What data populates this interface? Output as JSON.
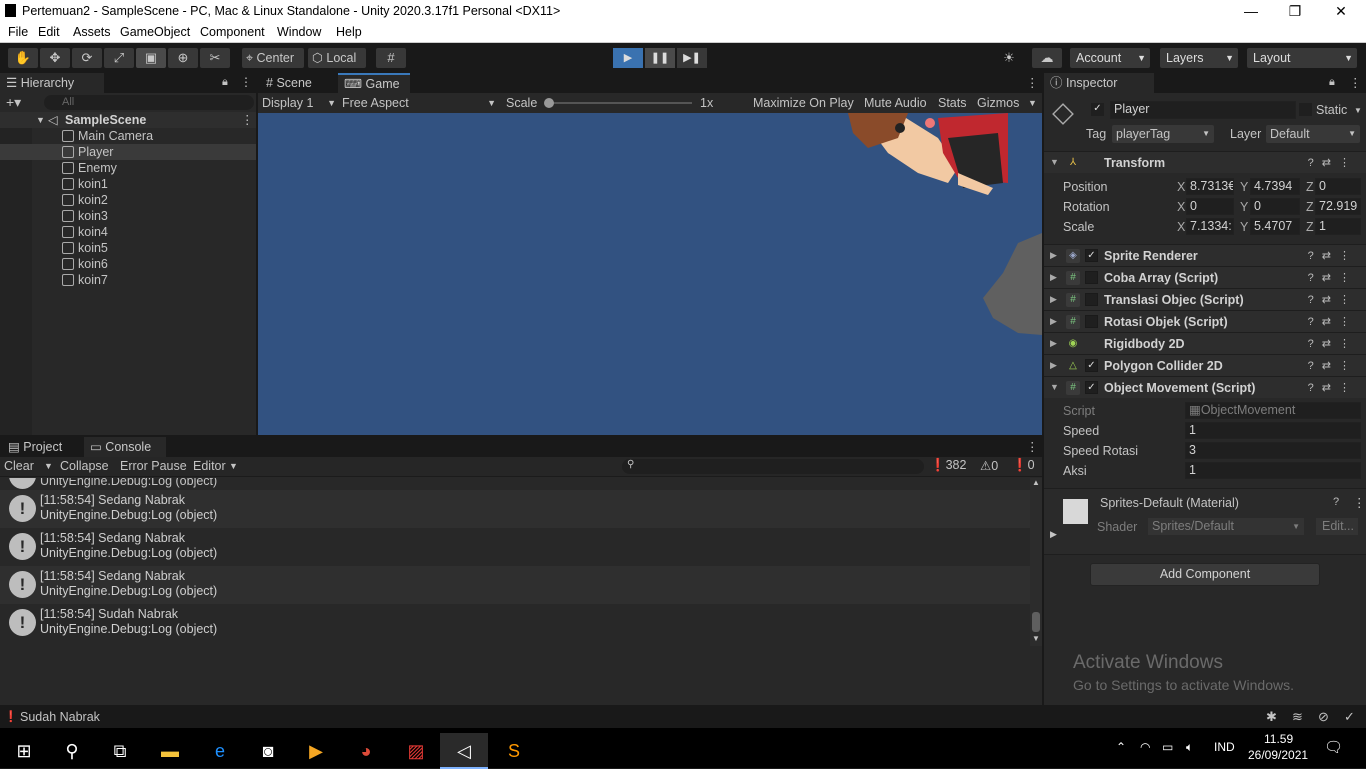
{
  "window": {
    "title": "Pertemuan2 - SampleScene - PC, Mac & Linux Standalone - Unity 2020.3.17f1 Personal <DX11>"
  },
  "menu": [
    "File",
    "Edit",
    "Assets",
    "GameObject",
    "Component",
    "Window",
    "Help"
  ],
  "toolbar": {
    "center": "Center",
    "local": "Local",
    "account": "Account",
    "layers": "Layers",
    "layout": "Layout"
  },
  "hierarchy": {
    "tab": "Hierarchy",
    "search_placeholder": "All",
    "scene": "SampleScene",
    "items": [
      "Main Camera",
      "Player",
      "Enemy",
      "koin1",
      "koin2",
      "koin3",
      "koin4",
      "koin5",
      "koin6",
      "koin7"
    ]
  },
  "gameview": {
    "tabs": [
      "Scene",
      "Game"
    ],
    "display": "Display 1",
    "aspect": "Free Aspect",
    "scale_label": "Scale",
    "scale_value": "1x",
    "buttons": [
      "Maximize On Play",
      "Mute Audio",
      "Stats",
      "Gizmos"
    ]
  },
  "console": {
    "tabs": [
      "Project",
      "Console"
    ],
    "buttons": [
      "Clear",
      "Collapse",
      "Error Pause",
      "Editor"
    ],
    "counts": {
      "log": "382",
      "warn": "0",
      "error": "0"
    },
    "partial_line": "UnityEngine.Debug:Log (object)",
    "logs": [
      {
        "msg": "[11:58:54] Sedang Nabrak",
        "trace": "UnityEngine.Debug:Log (object)"
      },
      {
        "msg": "[11:58:54] Sedang Nabrak",
        "trace": "UnityEngine.Debug:Log (object)"
      },
      {
        "msg": "[11:58:54] Sedang Nabrak",
        "trace": "UnityEngine.Debug:Log (object)"
      },
      {
        "msg": "[11:58:54] Sudah Nabrak",
        "trace": "UnityEngine.Debug:Log (object)"
      }
    ]
  },
  "inspector": {
    "tab": "Inspector",
    "object_name": "Player",
    "static": "Static",
    "tag_label": "Tag",
    "tag": "playerTag",
    "layer_label": "Layer",
    "layer": "Default",
    "transform": {
      "title": "Transform",
      "position_label": "Position",
      "position": {
        "x": "8.7313€",
        "y": "4.7394",
        "z": "0"
      },
      "rotation_label": "Rotation",
      "rotation": {
        "x": "0",
        "y": "0",
        "z": "72.919"
      },
      "scale_label": "Scale",
      "scale": {
        "x": "7.1334:",
        "y": "5.4707",
        "z": "1"
      }
    },
    "components": [
      "Sprite Renderer",
      "Coba Array (Script)",
      "Translasi Objec (Script)",
      "Rotasi Objek (Script)",
      "Rigidbody 2D",
      "Polygon Collider 2D",
      "Object Movement (Script)"
    ],
    "script_fields": {
      "script_label": "Script",
      "script": "ObjectMovement",
      "speed_label": "Speed",
      "speed": "1",
      "speed_rot_label": "Speed Rotasi",
      "speed_rot": "3",
      "aksi_label": "Aksi",
      "aksi": "1"
    },
    "material": {
      "name": "Sprites-Default (Material)",
      "shader_label": "Shader",
      "shader": "Sprites/Default",
      "edit": "Edit..."
    },
    "add_component": "Add Component",
    "activate_title": "Activate Windows",
    "activate_sub": "Go to Settings to activate Windows."
  },
  "statusbar": {
    "text": "Sudah Nabrak"
  },
  "taskbar": {
    "lang": "IND",
    "time": "11.59",
    "date": "26/09/2021"
  }
}
